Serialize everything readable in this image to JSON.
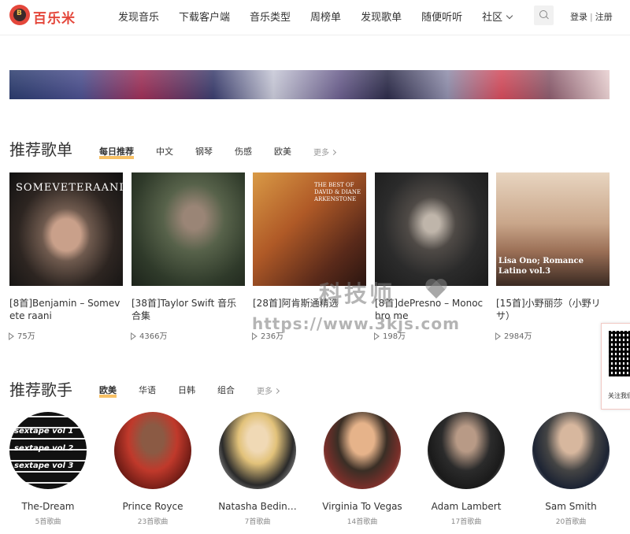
{
  "header": {
    "logo_text": "百乐米",
    "nav": [
      "发现音乐",
      "下载客户端",
      "音乐类型",
      "周榜单",
      "发现歌单",
      "随便听听",
      "社区"
    ],
    "login": "登录",
    "separator": "|",
    "register": "注册"
  },
  "playlists": {
    "title": "推荐歌单",
    "tabs": [
      "每日推荐",
      "中文",
      "钢琴",
      "伤感",
      "欧美"
    ],
    "active_tab": "每日推荐",
    "more": "更多",
    "items": [
      {
        "title": "[8首]Benjamin – Somevete raani",
        "plays": "75万",
        "cover_text": "SOMEVETERAANI"
      },
      {
        "title": "[38首]Taylor Swift 音乐合集",
        "plays": "4366万",
        "cover_text": ""
      },
      {
        "title": "[28首]阿肯斯通精选",
        "plays": "236万",
        "cover_text": "THE BEST OF DAVID & DIANE ARKENSTONE"
      },
      {
        "title": "[8首]dePresno – Monochro me",
        "plays": "198万",
        "cover_text": ""
      },
      {
        "title": "[15首]小野丽莎（小野リサ）",
        "plays": "2984万",
        "cover_text": "Lisa Ono; Romance Latino vol.3"
      }
    ]
  },
  "singers": {
    "title": "推荐歌手",
    "tabs": [
      "欧美",
      "华语",
      "日韩",
      "组合"
    ],
    "active_tab": "欧美",
    "more": "更多",
    "items": [
      {
        "name": "The-Dream",
        "count": "5首歌曲",
        "avatar_text": "sextape vol 1 sextape vol 2 sextape vol 3"
      },
      {
        "name": "Prince Royce",
        "count": "23首歌曲"
      },
      {
        "name": "Natasha Bedin…",
        "count": "7首歌曲"
      },
      {
        "name": "Virginia To Vegas",
        "count": "14首歌曲"
      },
      {
        "name": "Adam Lambert",
        "count": "17首歌曲"
      },
      {
        "name": "Sam Smith",
        "count": "20首歌曲"
      }
    ]
  },
  "qr": {
    "label": "关注我们"
  },
  "watermark": {
    "text_cn": "科技师",
    "url": "https://www.3kjs.com"
  },
  "colors": {
    "brand": "#e4473b",
    "tab_underline": "#f5a623"
  }
}
